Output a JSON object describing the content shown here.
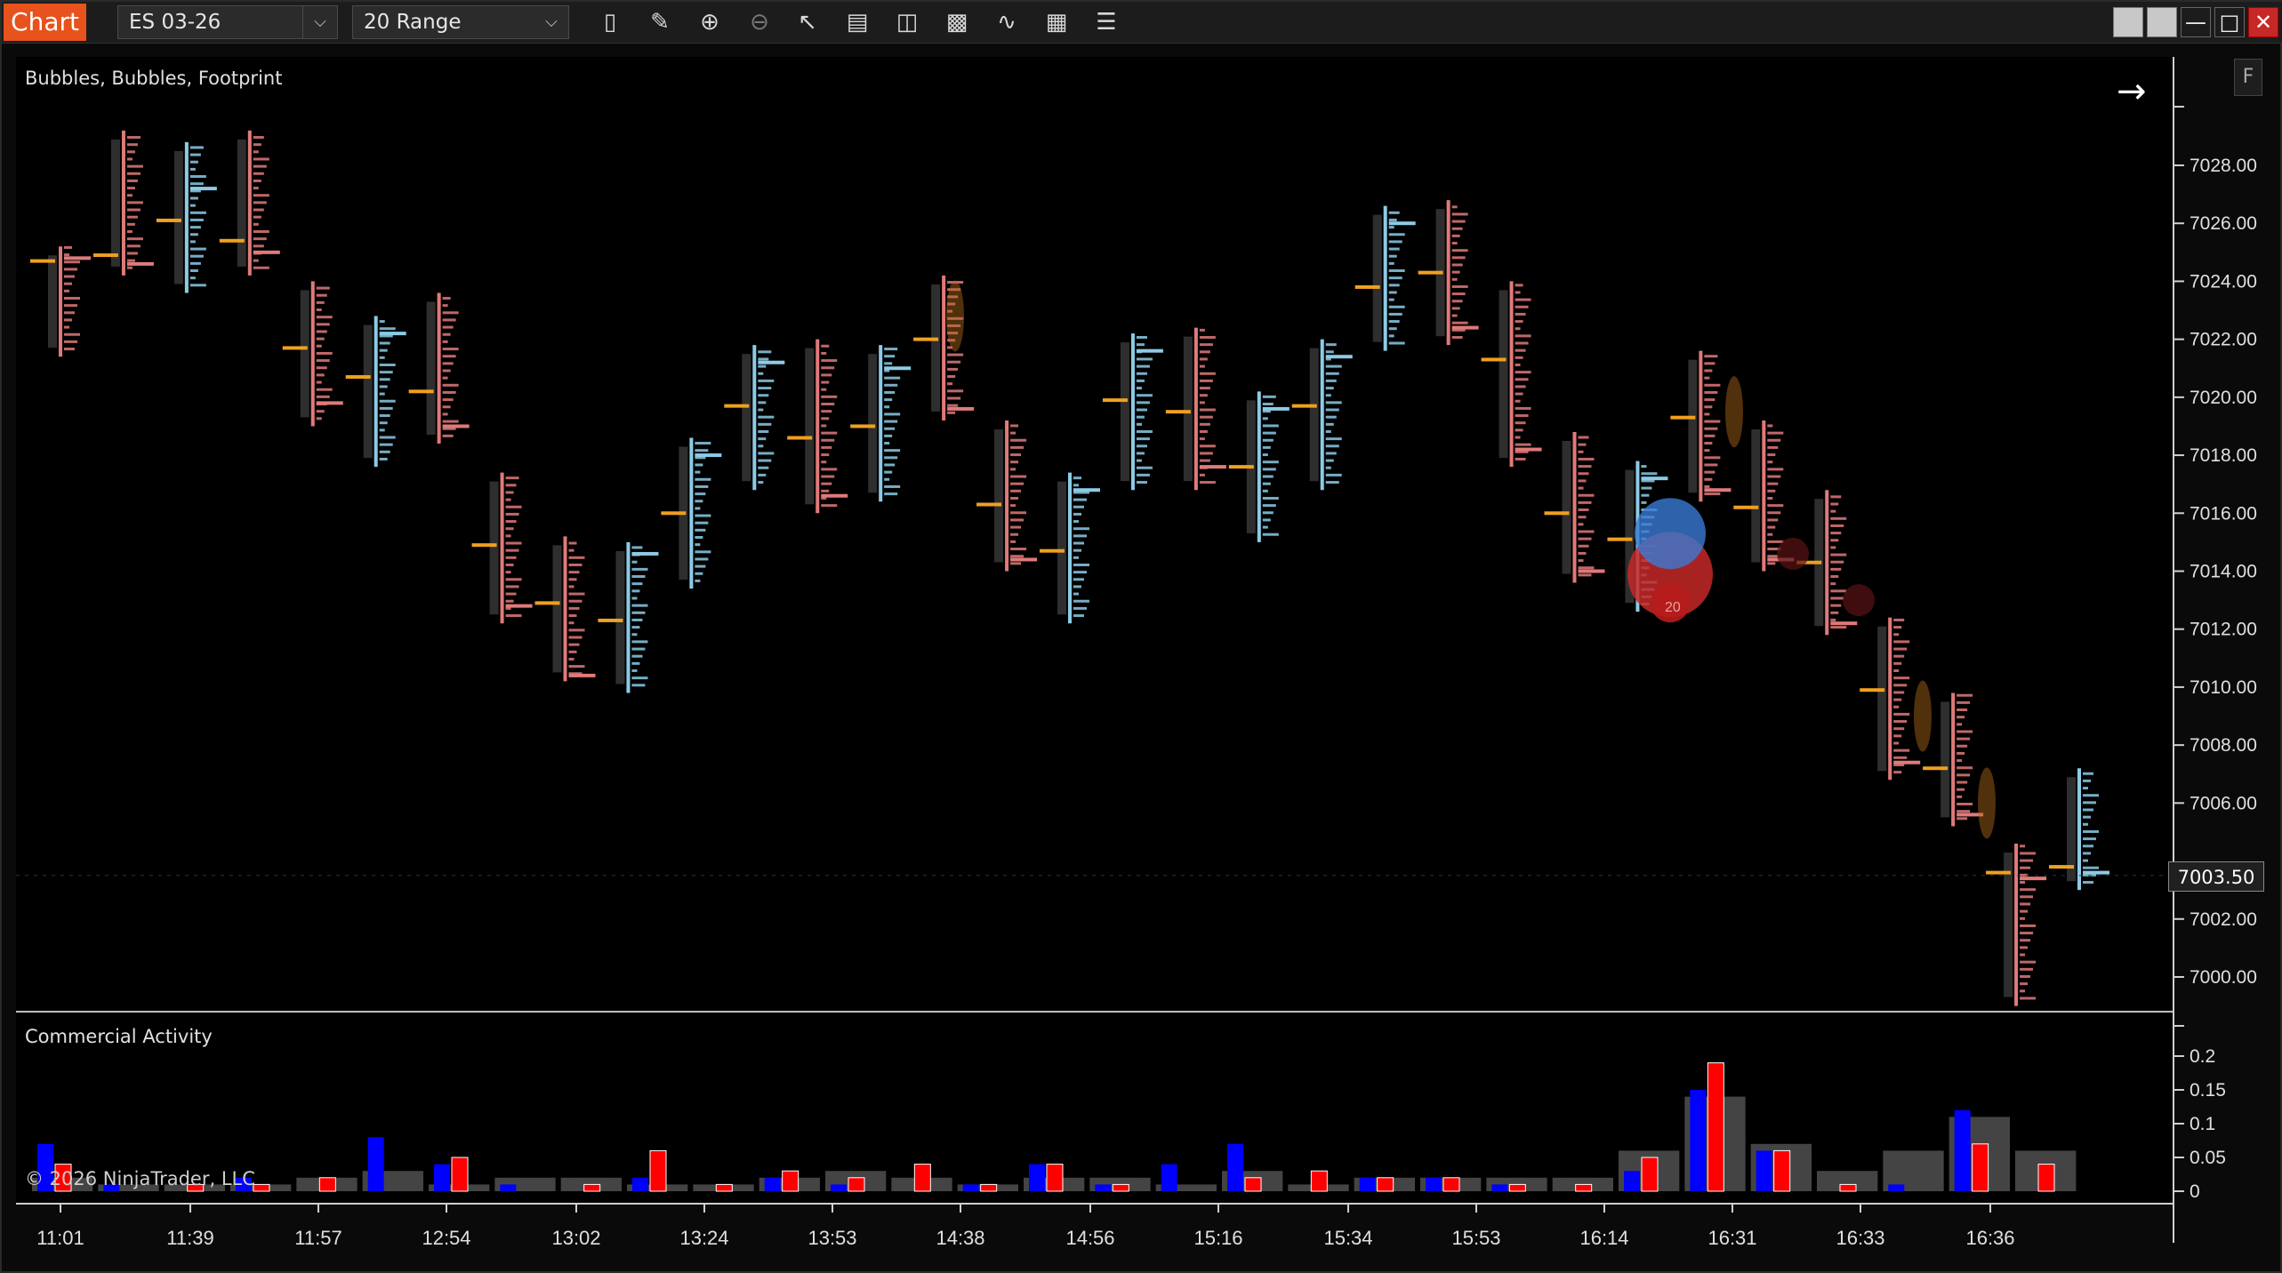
{
  "toolbar": {
    "tab": "Chart",
    "instrument": "ES 03-26",
    "bar_type": "20 Range",
    "icons": [
      "bar-type-icon",
      "draw-tool-icon",
      "zoom-in-icon",
      "zoom-out-icon",
      "pointer-icon",
      "data-box-icon",
      "strategy-icon",
      "indicators-icon",
      "properties-icon",
      "template-icon",
      "chart-trader-icon"
    ],
    "window_buttons": [
      "tile-icon",
      "tile-icon",
      "minimize-icon",
      "maximize-icon",
      "close-icon"
    ]
  },
  "panel_main": {
    "title": "Bubbles, Bubbles, Footprint",
    "current_price": "7003.50",
    "y_labels": [
      "7028.00",
      "7026.00",
      "7024.00",
      "7022.00",
      "7020.00",
      "7018.00",
      "7016.00",
      "7014.00",
      "7012.00",
      "7010.00",
      "7008.00",
      "7006.00",
      "7004.00",
      "7002.00",
      "7000.00"
    ],
    "bubble_label": "20",
    "f_button": "F"
  },
  "panel_lower": {
    "title": "Commercial Activity",
    "y_labels": [
      "0.2",
      "0.15",
      "0.1",
      "0.05",
      "0"
    ]
  },
  "copyright": "© 2026 NinjaTrader, LLC",
  "x_labels": [
    "11:01",
    "11:39",
    "11:57",
    "12:54",
    "13:02",
    "13:24",
    "13:53",
    "14:38",
    "14:56",
    "15:16",
    "15:34",
    "15:53",
    "16:14",
    "16:31",
    "16:33",
    "16:36"
  ],
  "colors": {
    "up": "#8ccbe6",
    "down": "#e07a7a",
    "poc": "#f0a020",
    "blue": "#0000ff",
    "red": "#ff0000",
    "gray": "#444444"
  },
  "chart_data": {
    "type": "candlestick-footprint",
    "bars": [
      {
        "low": 7021.4,
        "high": 7025.2,
        "open": 7025.2,
        "close": 7024.8
      },
      {
        "low": 7024.2,
        "high": 7029.2,
        "open": 7025.2,
        "close": 7024.6
      },
      {
        "low": 7023.6,
        "high": 7028.8,
        "open": 7024.4,
        "close": 7027.2
      },
      {
        "low": 7024.2,
        "high": 7029.2,
        "open": 7026.4,
        "close": 7025.0
      },
      {
        "low": 7019.0,
        "high": 7024.0,
        "open": 7023.6,
        "close": 7019.8
      },
      {
        "low": 7017.6,
        "high": 7022.8,
        "open": 7018.6,
        "close": 7022.2
      },
      {
        "low": 7018.4,
        "high": 7023.6,
        "open": 7022.0,
        "close": 7019.0
      },
      {
        "low": 7012.2,
        "high": 7017.4,
        "open": 7017.0,
        "close": 7012.8
      },
      {
        "low": 7010.2,
        "high": 7015.2,
        "open": 7014.8,
        "close": 7010.4
      },
      {
        "low": 7009.8,
        "high": 7015.0,
        "open": 7010.6,
        "close": 7014.6
      },
      {
        "low": 7013.4,
        "high": 7018.6,
        "open": 7014.0,
        "close": 7018.0
      },
      {
        "low": 7016.8,
        "high": 7021.8,
        "open": 7017.6,
        "close": 7021.2
      },
      {
        "low": 7016.0,
        "high": 7022.0,
        "open": 7021.2,
        "close": 7016.6
      },
      {
        "low": 7016.4,
        "high": 7021.8,
        "open": 7017.0,
        "close": 7021.0
      },
      {
        "low": 7019.2,
        "high": 7024.2,
        "open": 7023.8,
        "close": 7019.6
      },
      {
        "low": 7014.0,
        "high": 7019.2,
        "open": 7018.8,
        "close": 7014.4
      },
      {
        "low": 7012.2,
        "high": 7017.4,
        "open": 7012.6,
        "close": 7016.8
      },
      {
        "low": 7016.8,
        "high": 7022.2,
        "open": 7017.6,
        "close": 7021.6
      },
      {
        "low": 7016.8,
        "high": 7022.4,
        "open": 7022.0,
        "close": 7017.6
      },
      {
        "low": 7015.0,
        "high": 7020.2,
        "open": 7015.6,
        "close": 7019.6
      },
      {
        "low": 7016.8,
        "high": 7022.0,
        "open": 7017.4,
        "close": 7021.4
      },
      {
        "low": 7021.6,
        "high": 7026.6,
        "open": 7022.2,
        "close": 7026.0
      },
      {
        "low": 7021.8,
        "high": 7026.8,
        "open": 7026.2,
        "close": 7022.4
      },
      {
        "low": 7017.6,
        "high": 7024.0,
        "open": 7023.8,
        "close": 7018.2
      },
      {
        "low": 7013.6,
        "high": 7018.8,
        "open": 7018.6,
        "close": 7014.0
      },
      {
        "low": 7012.6,
        "high": 7017.8,
        "open": 7013.0,
        "close": 7017.2
      },
      {
        "low": 7016.4,
        "high": 7021.6,
        "open": 7021.2,
        "close": 7016.8
      },
      {
        "low": 7014.0,
        "high": 7019.2,
        "open": 7018.6,
        "close": 7014.4
      },
      {
        "low": 7011.8,
        "high": 7016.8,
        "open": 7016.4,
        "close": 7012.2
      },
      {
        "low": 7006.8,
        "high": 7012.4,
        "open": 7011.8,
        "close": 7007.4
      },
      {
        "low": 7005.2,
        "high": 7009.8,
        "open": 7009.4,
        "close": 7005.6
      },
      {
        "low": 6999.0,
        "high": 7004.6,
        "open": 7003.8,
        "close": 7003.4
      },
      {
        "low": 7003.0,
        "high": 7007.2,
        "open": 7003.4,
        "close": 7003.6
      }
    ],
    "commercial_activity": {
      "blue": [
        0.07,
        0.01,
        0.0,
        0.02,
        0.0,
        0.08,
        0.04,
        0.01,
        0.0,
        0.02,
        0.0,
        0.02,
        0.01,
        0.0,
        0.01,
        0.04,
        0.01,
        0.04,
        0.07,
        0.0,
        0.02,
        0.02,
        0.01,
        0.0,
        0.03,
        0.15,
        0.06,
        0.0,
        0.01,
        0.12,
        0.0
      ],
      "red": [
        0.04,
        0.0,
        0.01,
        0.01,
        0.02,
        0.0,
        0.05,
        0.0,
        0.01,
        0.06,
        0.01,
        0.03,
        0.02,
        0.04,
        0.01,
        0.04,
        0.01,
        0.0,
        0.02,
        0.03,
        0.02,
        0.02,
        0.01,
        0.01,
        0.05,
        0.19,
        0.06,
        0.01,
        0.0,
        0.07,
        0.04
      ],
      "gray": [
        0.02,
        0.01,
        0.01,
        0.01,
        0.02,
        0.03,
        0.01,
        0.02,
        0.02,
        0.01,
        0.01,
        0.02,
        0.03,
        0.02,
        0.01,
        0.02,
        0.02,
        0.01,
        0.03,
        0.01,
        0.02,
        0.02,
        0.02,
        0.02,
        0.06,
        0.14,
        0.07,
        0.03,
        0.06,
        0.11,
        0.06
      ]
    }
  }
}
